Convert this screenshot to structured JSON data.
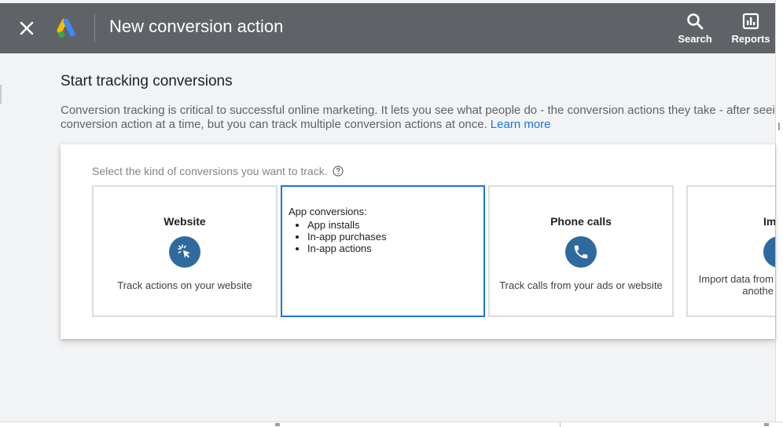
{
  "header": {
    "title": "New conversion action",
    "search_label": "Search",
    "reports_label": "Reports"
  },
  "icons": {
    "close": "close-icon",
    "logo": "google-ads-logo",
    "search": "search-icon",
    "reports": "bar-chart-icon",
    "help": "help-circle-icon",
    "website": "cursor-click-icon",
    "phone": "phone-icon",
    "import": "import-icon"
  },
  "colors": {
    "header_bg": "#5f6368",
    "accent": "#1a73e8",
    "icon_circle": "#2f6a9f",
    "logo_yellow": "#fbbc04",
    "logo_blue": "#4285f4",
    "logo_green": "#34a853"
  },
  "main": {
    "section_title": "Start tracking conversions",
    "description_line1": "Conversion tracking is critical to successful online marketing. It lets you see what people do - the conversion actions they take - after seei",
    "description_line2": "conversion action at a time, but you can track multiple conversion actions at once.",
    "learn_more": "Learn more",
    "prompt": "Select the kind of conversions you want to track."
  },
  "cards": {
    "website": {
      "title": "Website",
      "description": "Track actions on your website"
    },
    "app": {
      "title": "App conversions:",
      "items": [
        "App installs",
        "In-app purchases",
        "In-app actions"
      ]
    },
    "phone": {
      "title": "Phone calls",
      "description": "Track calls from your ads or website"
    },
    "import": {
      "title": "Im",
      "description_line1": "Import data from",
      "description_line2": "anothe"
    }
  }
}
